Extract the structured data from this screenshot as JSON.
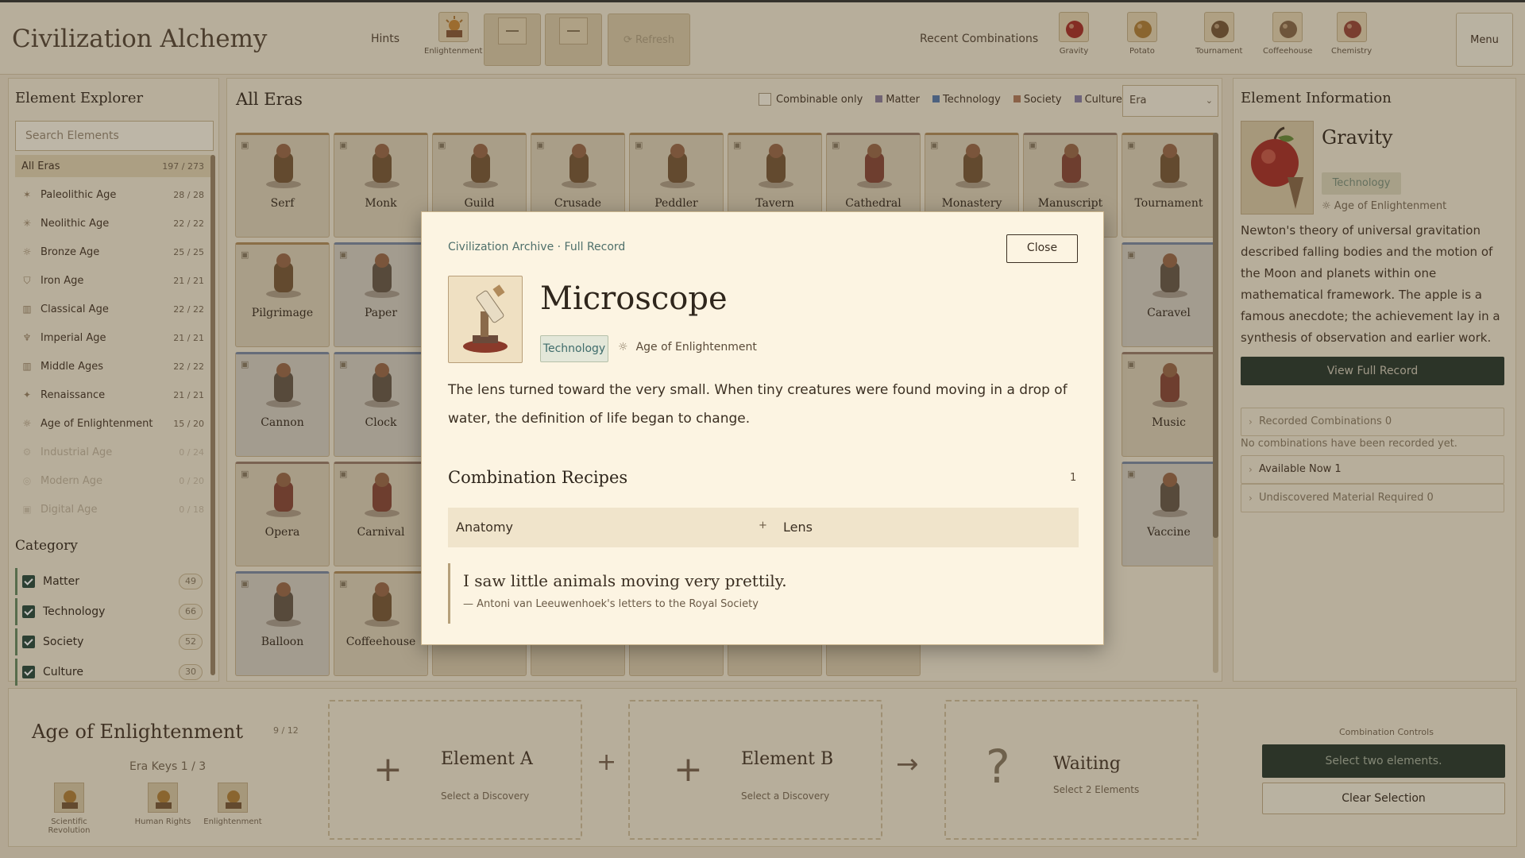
{
  "app": {
    "title": "Civilization Alchemy",
    "hints_label": "Hints",
    "refresh_label": "⟳ Refresh",
    "recent_label": "Recent Combinations",
    "menu_label": "Menu"
  },
  "hint_slot": {
    "label": "Enlightenment",
    "icon": "sun-temple-icon"
  },
  "recent": [
    {
      "label": "Gravity",
      "icon": "apple-icon"
    },
    {
      "label": "Potato",
      "icon": "potato-icon"
    },
    {
      "label": "Tournament",
      "icon": "knight-icon"
    },
    {
      "label": "Coffeehouse",
      "icon": "coffee-icon"
    },
    {
      "label": "Chemistry",
      "icon": "flask-icon"
    }
  ],
  "explorer": {
    "title": "Element Explorer",
    "search_placeholder": "Search Elements",
    "all_eras": {
      "label": "All Eras",
      "count": "197 / 273"
    },
    "eras": [
      {
        "label": "Paleolithic Age",
        "count": "28 / 28",
        "icon": "flame-icon"
      },
      {
        "label": "Neolithic Age",
        "count": "22 / 22",
        "icon": "wheat-icon"
      },
      {
        "label": "Bronze Age",
        "count": "25 / 25",
        "icon": "sun-icon"
      },
      {
        "label": "Iron Age",
        "count": "21 / 21",
        "icon": "shield-icon"
      },
      {
        "label": "Classical Age",
        "count": "22 / 22",
        "icon": "column-icon"
      },
      {
        "label": "Imperial Age",
        "count": "21 / 21",
        "icon": "laurel-icon"
      },
      {
        "label": "Middle Ages",
        "count": "22 / 22",
        "icon": "castle-icon"
      },
      {
        "label": "Renaissance",
        "count": "21 / 21",
        "icon": "compass-icon"
      },
      {
        "label": "Age of Enlightenment",
        "count": "15 / 20",
        "icon": "sun-rays-icon"
      },
      {
        "label": "Industrial Age",
        "count": "0 / 24",
        "icon": "gear-icon"
      },
      {
        "label": "Modern Age",
        "count": "0 / 20",
        "icon": "atom-icon"
      },
      {
        "label": "Digital Age",
        "count": "0 / 18",
        "icon": "chip-icon"
      }
    ],
    "category_title": "Category",
    "categories": [
      {
        "label": "Matter",
        "count": "49"
      },
      {
        "label": "Technology",
        "count": "66"
      },
      {
        "label": "Society",
        "count": "52"
      },
      {
        "label": "Culture",
        "count": "30"
      }
    ]
  },
  "main": {
    "title": "All Eras",
    "combinable_label": "Combinable only",
    "legend": [
      {
        "label": "Matter",
        "color": "#8c7d97"
      },
      {
        "label": "Technology",
        "color": "#5a7aa8"
      },
      {
        "label": "Society",
        "color": "#b07a5a"
      },
      {
        "label": "Culture",
        "color": "#8a7da0"
      }
    ],
    "era_select": "Era",
    "cards": [
      {
        "name": "Serf",
        "type": "soc",
        "icon": "serf-icon"
      },
      {
        "name": "Monk",
        "type": "soc",
        "icon": "monk-icon"
      },
      {
        "name": "Guild",
        "type": "soc",
        "icon": "tools-icon"
      },
      {
        "name": "Crusade",
        "type": "soc",
        "icon": "crusade-icon"
      },
      {
        "name": "Peddler",
        "type": "soc",
        "icon": "peddler-icon"
      },
      {
        "name": "Tavern",
        "type": "soc",
        "icon": "tavern-icon"
      },
      {
        "name": "Cathedral",
        "type": "cult",
        "icon": "cathedral-icon"
      },
      {
        "name": "Monastery",
        "type": "soc",
        "icon": "monastery-icon"
      },
      {
        "name": "Manuscript",
        "type": "cult",
        "icon": "book-icon"
      },
      {
        "name": "Tournament",
        "type": "soc",
        "icon": "knight-icon"
      },
      {
        "name": "Pilgrimage",
        "type": "soc",
        "icon": "pilgrim-icon"
      },
      {
        "name": "Paper",
        "type": "tech",
        "icon": "paper-icon"
      },
      {
        "name": "Caravel",
        "type": "tech",
        "icon": "ship-icon"
      },
      {
        "name": "Cannon",
        "type": "tech",
        "icon": "cannon-icon"
      },
      {
        "name": "Clock",
        "type": "tech",
        "icon": "clock-icon"
      },
      {
        "name": "Music",
        "type": "cult",
        "icon": "lute-icon"
      },
      {
        "name": "Opera",
        "type": "cult",
        "icon": "opera-icon"
      },
      {
        "name": "Carnival",
        "type": "cult",
        "icon": "mask-icon"
      },
      {
        "name": "Vaccine",
        "type": "tech",
        "icon": "vaccine-icon"
      },
      {
        "name": "Balloon",
        "type": "tech",
        "icon": "balloon-icon"
      },
      {
        "name": "Coffeehouse",
        "type": "soc",
        "icon": "coffee-icon"
      }
    ]
  },
  "info": {
    "name": "Gravity",
    "tag": "Technology",
    "era": "Age of Enlightenment",
    "description": "Newton's theory of universal gravitation described falling bodies and the motion of the Moon and planets within one mathematical framework. The apple is a famous anecdote; the achievement lay in a synthesis of observation and earlier work.",
    "full_record_label": "View Full Record",
    "recorded": "Recorded Combinations  0",
    "no_combinations": "No combinations have been recorded yet.",
    "available": "Available Now  1",
    "undiscovered": "Undiscovered Material Required  0"
  },
  "bottom": {
    "era_title": "Age of Enlightenment",
    "era_count": "9 / 12",
    "keys_label": "Era Keys  1 / 3",
    "keys": [
      {
        "label": "Scientific Revolution",
        "icon": "orrery-icon"
      },
      {
        "label": "Human Rights",
        "icon": "scroll-icon"
      },
      {
        "label": "Enlightenment",
        "icon": "sun-temple-icon"
      }
    ],
    "element_a": {
      "title": "Element A",
      "sub": "Select a Discovery"
    },
    "element_b": {
      "title": "Element B",
      "sub": "Select a Discovery"
    },
    "result": {
      "title": "Waiting",
      "sub": "Select 2 Elements"
    },
    "plus": "+",
    "arrow": "→",
    "question": "?",
    "controls_label": "Combination Controls",
    "primary_label": "Select two elements.",
    "clear_label": "Clear Selection"
  },
  "modal": {
    "kicker": "Civilization Archive · Full Record",
    "close_label": "Close",
    "name": "Microscope",
    "tag": "Technology",
    "era": "Age of Enlightenment",
    "description": "The lens turned toward the very small. When tiny creatures were found moving in a drop of water, the definition of life began to change.",
    "recipes_title": "Combination Recipes",
    "recipes_count": "1",
    "recipe": {
      "a": "Anatomy",
      "plus": "+",
      "b": "Lens"
    },
    "quote": "I saw little animals moving very prettily.",
    "quote_source": "— Antoni van Leeuwenhoek's letters to the Royal Society"
  }
}
